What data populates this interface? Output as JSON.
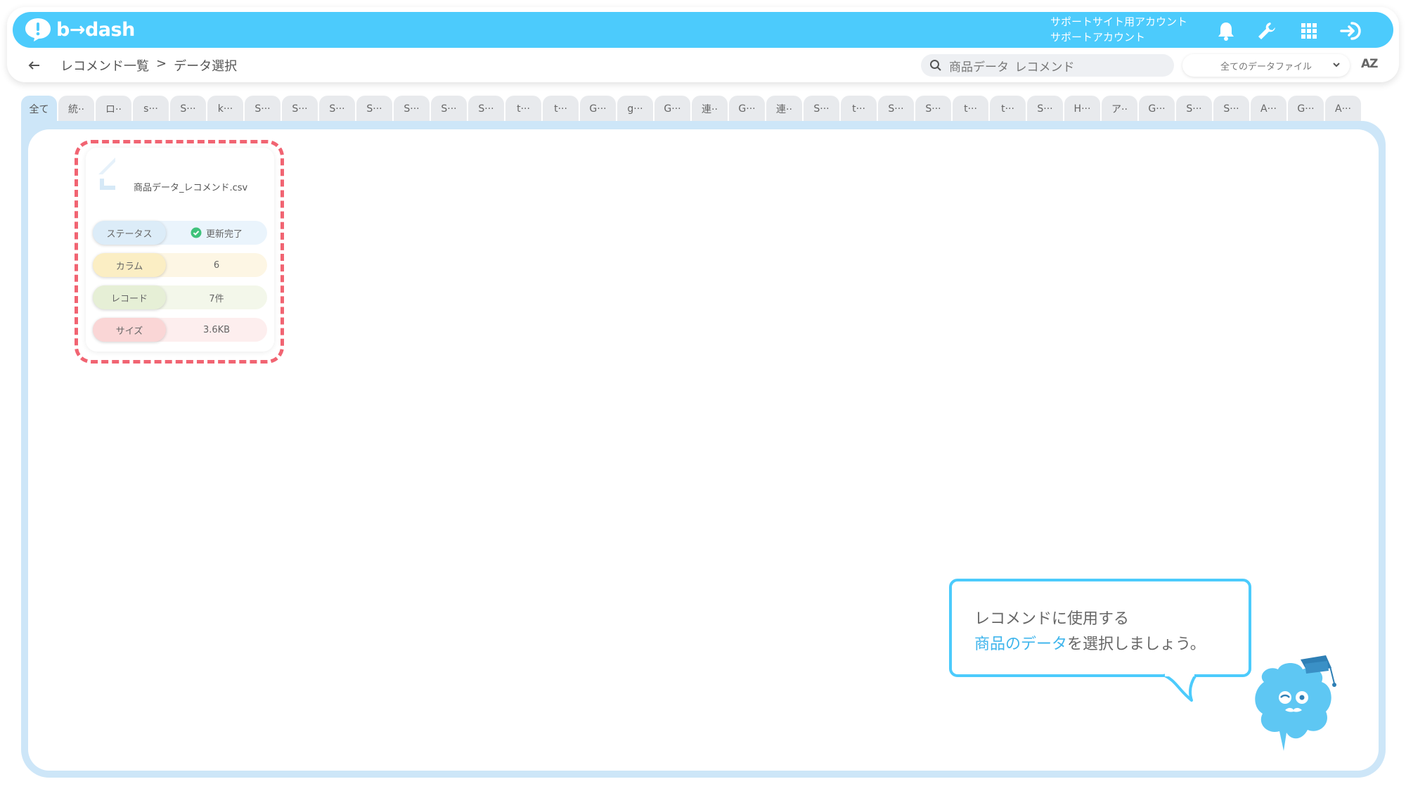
{
  "app": {
    "logo_text": "b→dash",
    "account_line1": "サポートサイト用アカウント",
    "account_line2": "サポートアカウント",
    "accent_color": "#4ccbfc"
  },
  "header_icons": [
    "bell-icon",
    "wrench-icon",
    "apps-grid-icon",
    "logout-icon"
  ],
  "subbar": {
    "breadcrumb_parent": "レコメンド一覧",
    "breadcrumb_sep": ">",
    "breadcrumb_current": "データ選択",
    "search_value": "商品データ_レコメンド",
    "file_filter": "全てのデータファイル",
    "sort_label": "AZ"
  },
  "tabs": [
    "全て",
    "統··",
    "ロ··",
    "s···",
    "S···",
    "k···",
    "S···",
    "S···",
    "S···",
    "S···",
    "S···",
    "S···",
    "S···",
    "t···",
    "t···",
    "G···",
    "g···",
    "G···",
    "連··",
    "G···",
    "連··",
    "S···",
    "t···",
    "S···",
    "S···",
    "t···",
    "t···",
    "S···",
    "H···",
    "ア··",
    "G···",
    "S···",
    "S···",
    "A···",
    "G···",
    "A···"
  ],
  "card": {
    "file_name": "商品データ_レコメンド.csv",
    "status_label": "ステータス",
    "status_value": "更新完了",
    "column_label": "カラム",
    "column_value": "6",
    "record_label": "レコード",
    "record_value": "7件",
    "size_label": "サイズ",
    "size_value": "3.6KB",
    "highlight_color": "#f16472"
  },
  "guide": {
    "line1": "レコメンドに使用する",
    "line2_highlight": "商品のデータ",
    "line2_rest": "を選択しましょう。"
  }
}
